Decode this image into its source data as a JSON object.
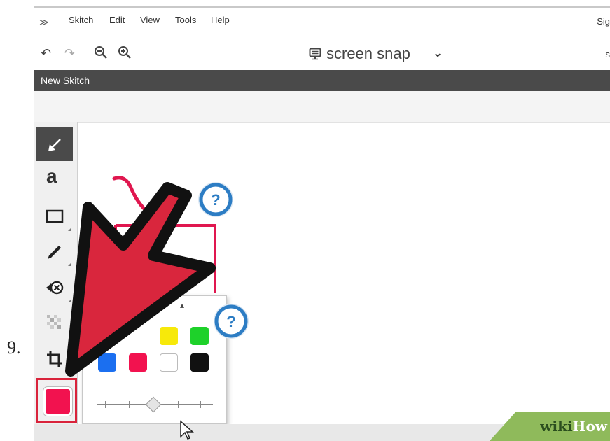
{
  "menubar": {
    "logo": "≫",
    "items": [
      "Skitch",
      "Edit",
      "View",
      "Tools",
      "Help"
    ],
    "signin_cut": "Sig"
  },
  "toolbar": {
    "undo_icon": "undo-icon",
    "redo_icon": "redo-icon",
    "zoom_out_icon": "zoom-out-icon",
    "zoom_in_icon": "zoom-in-icon",
    "snap_label": "screen snap",
    "share_cut": "s"
  },
  "document": {
    "title": "New Skitch"
  },
  "tools": [
    {
      "name": "arrow-tool",
      "icon": "arrow-icon",
      "active": true
    },
    {
      "name": "text-tool",
      "label": "a"
    },
    {
      "name": "rectangle-tool",
      "icon": "rectangle-icon"
    },
    {
      "name": "pen-tool",
      "icon": "pen-icon"
    },
    {
      "name": "stamp-tool",
      "icon": "stamp-icon"
    },
    {
      "name": "pixelate-tool",
      "icon": "pixelate-icon"
    },
    {
      "name": "crop-tool",
      "icon": "crop-icon"
    },
    {
      "name": "color-tool",
      "color": "#f2124f"
    }
  ],
  "step_number": "9.",
  "color_palette": {
    "colors": [
      "#fb8c1c",
      "#f7e90a",
      "#1ed12a",
      "#1b6ff0",
      "#f2124f",
      "#ffffff",
      "#111111"
    ],
    "selected": "#f2124f"
  },
  "accent": "#e0174f",
  "watermark": {
    "wiki": "wiki",
    "how": "How"
  }
}
